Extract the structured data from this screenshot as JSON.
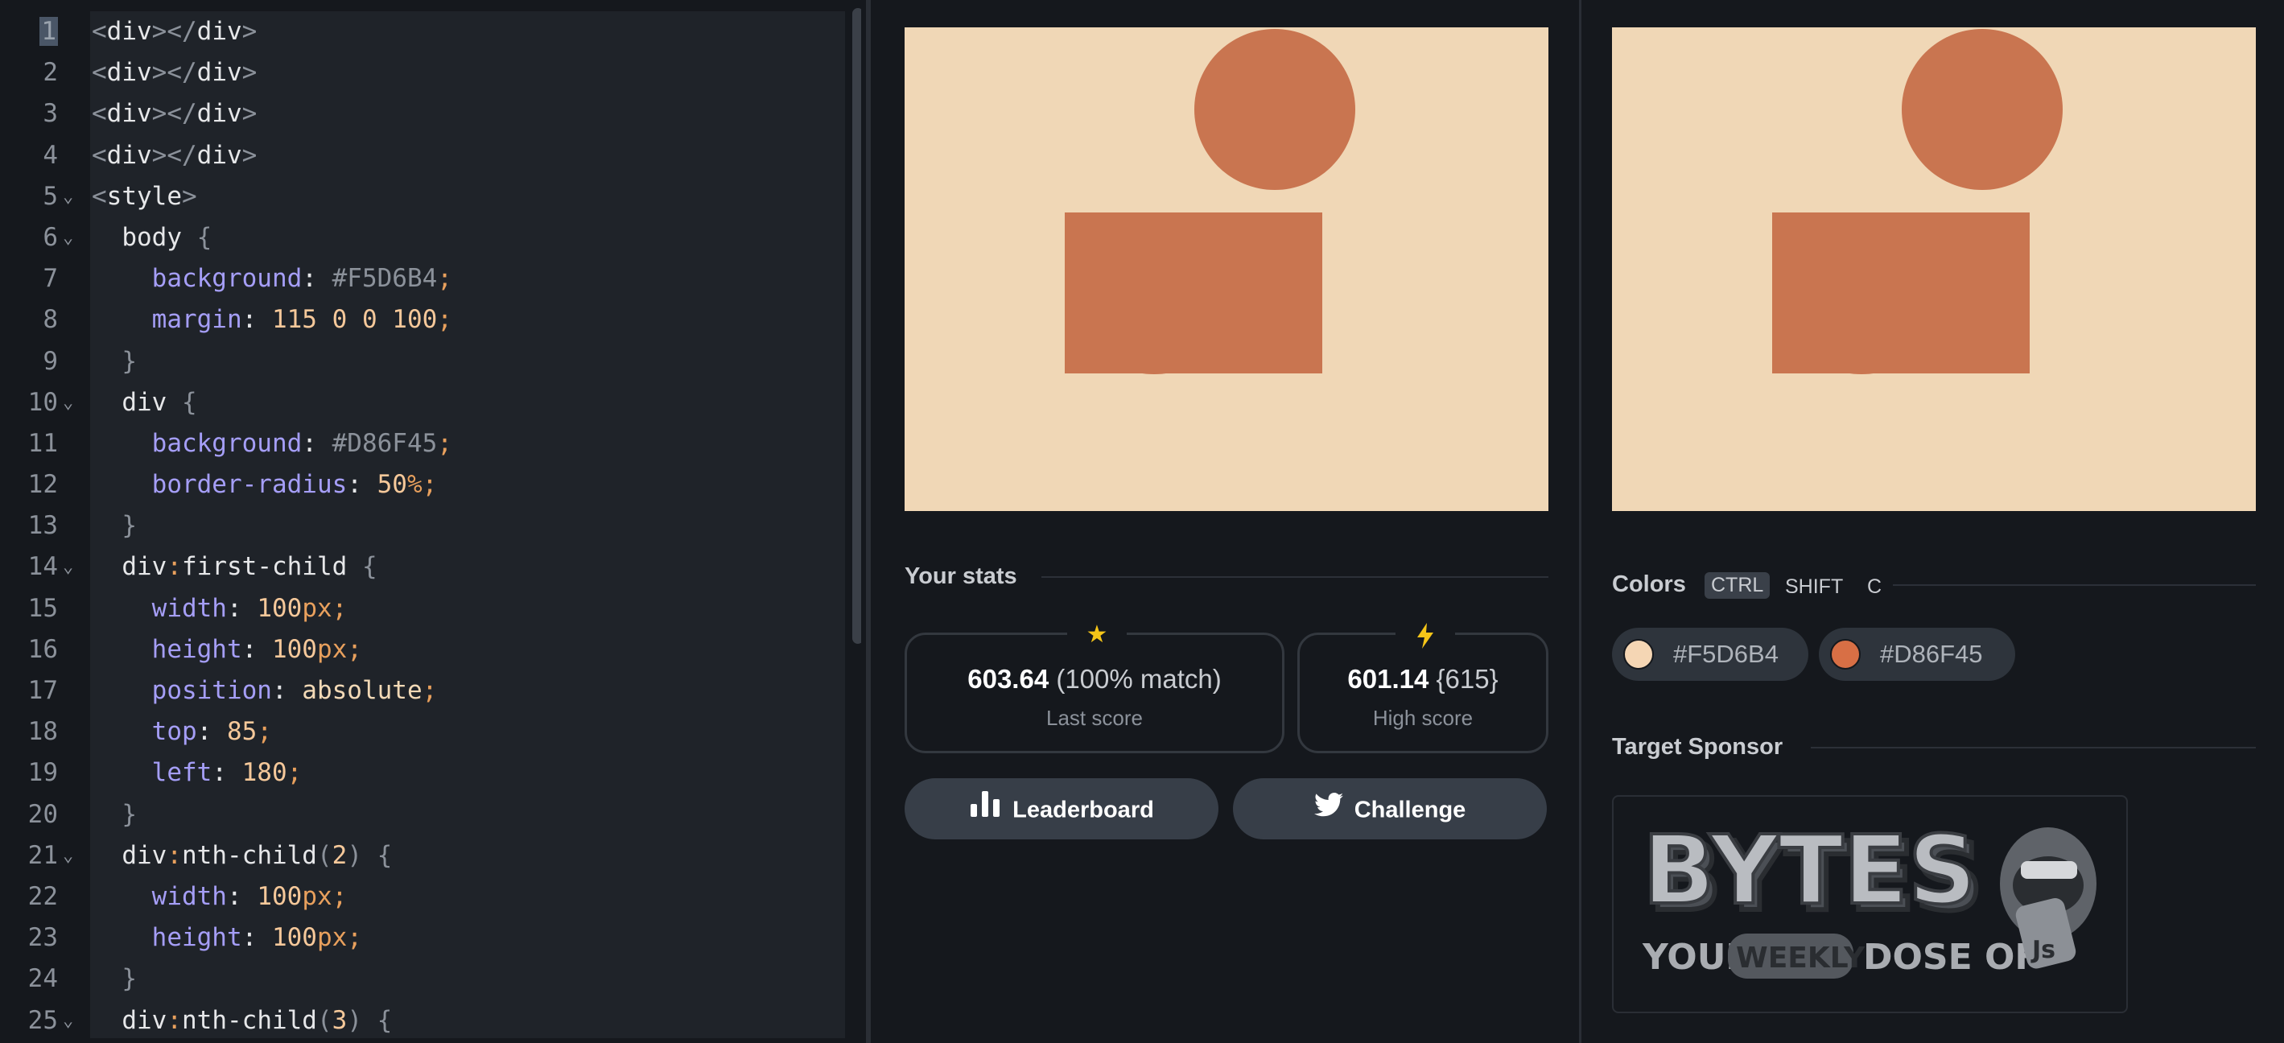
{
  "editor": {
    "active_line": 1,
    "lines": [
      {
        "n": "1",
        "fold": "",
        "tokens": [
          [
            "t-pun",
            "<"
          ],
          [
            "t-tag",
            "div"
          ],
          [
            "t-pun",
            ">"
          ],
          [
            "t-pun",
            "</"
          ],
          [
            "t-tag",
            "div"
          ],
          [
            "t-pun",
            ">"
          ]
        ]
      },
      {
        "n": "2",
        "fold": "",
        "tokens": [
          [
            "t-pun",
            "<"
          ],
          [
            "t-tag",
            "div"
          ],
          [
            "t-pun",
            ">"
          ],
          [
            "t-pun",
            "</"
          ],
          [
            "t-tag",
            "div"
          ],
          [
            "t-pun",
            ">"
          ]
        ]
      },
      {
        "n": "3",
        "fold": "",
        "tokens": [
          [
            "t-pun",
            "<"
          ],
          [
            "t-tag",
            "div"
          ],
          [
            "t-pun",
            ">"
          ],
          [
            "t-pun",
            "</"
          ],
          [
            "t-tag",
            "div"
          ],
          [
            "t-pun",
            ">"
          ]
        ]
      },
      {
        "n": "4",
        "fold": "",
        "tokens": [
          [
            "t-pun",
            "<"
          ],
          [
            "t-tag",
            "div"
          ],
          [
            "t-pun",
            ">"
          ],
          [
            "t-pun",
            "</"
          ],
          [
            "t-tag",
            "div"
          ],
          [
            "t-pun",
            ">"
          ]
        ]
      },
      {
        "n": "5",
        "fold": "⌄",
        "tokens": [
          [
            "t-pun",
            "<"
          ],
          [
            "t-tag",
            "style"
          ],
          [
            "t-pun",
            ">"
          ]
        ]
      },
      {
        "n": "6",
        "fold": "⌄",
        "tokens": [
          [
            "t-sel",
            "  body "
          ],
          [
            "t-pun",
            "{"
          ]
        ]
      },
      {
        "n": "7",
        "fold": "",
        "tokens": [
          [
            "t-prop",
            "    background"
          ],
          [
            "t-tag",
            ": "
          ],
          [
            "t-hex",
            "#F5D6B4"
          ],
          [
            "t-unit",
            ";"
          ]
        ]
      },
      {
        "n": "8",
        "fold": "",
        "tokens": [
          [
            "t-prop",
            "    margin"
          ],
          [
            "t-tag",
            ": "
          ],
          [
            "t-num",
            "115 0 0 100"
          ],
          [
            "t-unit",
            ";"
          ]
        ]
      },
      {
        "n": "9",
        "fold": "",
        "tokens": [
          [
            "t-pun",
            "  }"
          ]
        ]
      },
      {
        "n": "10",
        "fold": "⌄",
        "tokens": [
          [
            "t-sel",
            "  div "
          ],
          [
            "t-pun",
            "{"
          ]
        ]
      },
      {
        "n": "11",
        "fold": "",
        "tokens": [
          [
            "t-prop",
            "    background"
          ],
          [
            "t-tag",
            ": "
          ],
          [
            "t-hex",
            "#D86F45"
          ],
          [
            "t-unit",
            ";"
          ]
        ]
      },
      {
        "n": "12",
        "fold": "",
        "tokens": [
          [
            "t-prop",
            "    border-radius"
          ],
          [
            "t-tag",
            ": "
          ],
          [
            "t-num",
            "50"
          ],
          [
            "t-unit",
            "%;"
          ]
        ]
      },
      {
        "n": "13",
        "fold": "",
        "tokens": [
          [
            "t-pun",
            "  }"
          ]
        ]
      },
      {
        "n": "14",
        "fold": "⌄",
        "tokens": [
          [
            "t-sel",
            "  div"
          ],
          [
            "t-unit",
            ":"
          ],
          [
            "t-sel",
            "first-child "
          ],
          [
            "t-pun",
            "{"
          ]
        ]
      },
      {
        "n": "15",
        "fold": "",
        "tokens": [
          [
            "t-prop",
            "    width"
          ],
          [
            "t-tag",
            ": "
          ],
          [
            "t-num",
            "100"
          ],
          [
            "t-unit",
            "px;"
          ]
        ]
      },
      {
        "n": "16",
        "fold": "",
        "tokens": [
          [
            "t-prop",
            "    height"
          ],
          [
            "t-tag",
            ": "
          ],
          [
            "t-num",
            "100"
          ],
          [
            "t-unit",
            "px;"
          ]
        ]
      },
      {
        "n": "17",
        "fold": "",
        "tokens": [
          [
            "t-prop",
            "    position"
          ],
          [
            "t-tag",
            ": "
          ],
          [
            "t-kw",
            "absolute"
          ],
          [
            "t-unit",
            ";"
          ]
        ]
      },
      {
        "n": "18",
        "fold": "",
        "tokens": [
          [
            "t-prop",
            "    top"
          ],
          [
            "t-tag",
            ": "
          ],
          [
            "t-num",
            "85"
          ],
          [
            "t-unit",
            ";"
          ]
        ]
      },
      {
        "n": "19",
        "fold": "",
        "tokens": [
          [
            "t-prop",
            "    left"
          ],
          [
            "t-tag",
            ": "
          ],
          [
            "t-num",
            "180"
          ],
          [
            "t-unit",
            ";"
          ]
        ]
      },
      {
        "n": "20",
        "fold": "",
        "tokens": [
          [
            "t-pun",
            "  }"
          ]
        ]
      },
      {
        "n": "21",
        "fold": "⌄",
        "tokens": [
          [
            "t-sel",
            "  div"
          ],
          [
            "t-unit",
            ":"
          ],
          [
            "t-sel",
            "nth-child"
          ],
          [
            "t-pun",
            "("
          ],
          [
            "t-num",
            "2"
          ],
          [
            "t-pun",
            ") {"
          ]
        ]
      },
      {
        "n": "22",
        "fold": "",
        "tokens": [
          [
            "t-prop",
            "    width"
          ],
          [
            "t-tag",
            ": "
          ],
          [
            "t-num",
            "100"
          ],
          [
            "t-unit",
            "px;"
          ]
        ]
      },
      {
        "n": "23",
        "fold": "",
        "tokens": [
          [
            "t-prop",
            "    height"
          ],
          [
            "t-tag",
            ": "
          ],
          [
            "t-num",
            "100"
          ],
          [
            "t-unit",
            "px;"
          ]
        ]
      },
      {
        "n": "24",
        "fold": "",
        "tokens": [
          [
            "t-pun",
            "  }"
          ]
        ]
      },
      {
        "n": "25",
        "fold": "⌄",
        "tokens": [
          [
            "t-sel",
            "  div"
          ],
          [
            "t-unit",
            ":"
          ],
          [
            "t-sel",
            "nth-child"
          ],
          [
            "t-pun",
            "("
          ],
          [
            "t-num",
            "3"
          ],
          [
            "t-pun",
            ") {"
          ]
        ]
      }
    ]
  },
  "colors": {
    "background": "#F0D7B6",
    "shape": "#C97550",
    "accent_star": "#F5C518"
  },
  "stats": {
    "heading": "Your stats",
    "last": {
      "score": "603.64",
      "match": "(100% match)",
      "label": "Last score",
      "icon": "star-icon"
    },
    "high": {
      "score": "601.14",
      "extra": "{615}",
      "label": "High score",
      "icon": "lightning-icon"
    }
  },
  "buttons": {
    "leaderboard": {
      "label": "Leaderboard",
      "icon": "bar-chart-icon"
    },
    "challenge": {
      "label": "Challenge",
      "icon": "twitter-icon"
    }
  },
  "palette": {
    "heading": "Colors",
    "shortcut": [
      "CTRL",
      "SHIFT",
      "C"
    ],
    "swatches": [
      {
        "hex": "#F5D6B4",
        "label": "#F5D6B4"
      },
      {
        "hex": "#D86F45",
        "label": "#D86F45"
      }
    ]
  },
  "sponsor": {
    "heading": "Target Sponsor",
    "brand": "BYTES",
    "tagline_left": "YOUR",
    "tagline_badge": "WEEKLY",
    "tagline_right": "DOSE OF",
    "js_badge": "Js"
  }
}
